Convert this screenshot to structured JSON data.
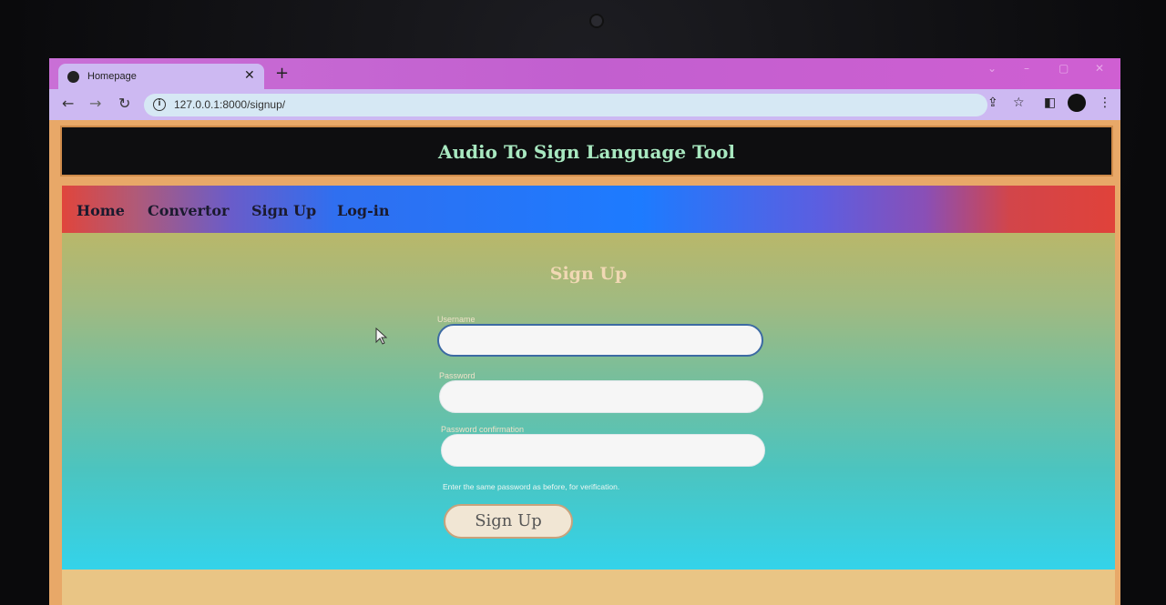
{
  "browser": {
    "tab_title": "Homepage",
    "tab_close": "✕",
    "new_tab": "+",
    "url": "127.0.0.1:8000/signup/"
  },
  "site": {
    "title": "Audio To Sign Language Tool"
  },
  "nav": {
    "items": [
      "Home",
      "Convertor",
      "Sign Up",
      "Log-in"
    ]
  },
  "form": {
    "title": "Sign Up",
    "username_label": "Username",
    "password_label": "Password",
    "password_confirm_label": "Password confirmation",
    "help_text": "Enter the same password as before, for verification.",
    "submit_label": "Sign Up"
  },
  "icons": {
    "back": "back-arrow-icon",
    "forward": "forward-arrow-icon",
    "reload": "reload-icon",
    "info": "info-icon",
    "share": "share-icon",
    "star": "star-icon",
    "sidepanel": "side-panel-icon",
    "profile": "profile-avatar-icon",
    "menu": "kebab-menu-icon"
  }
}
